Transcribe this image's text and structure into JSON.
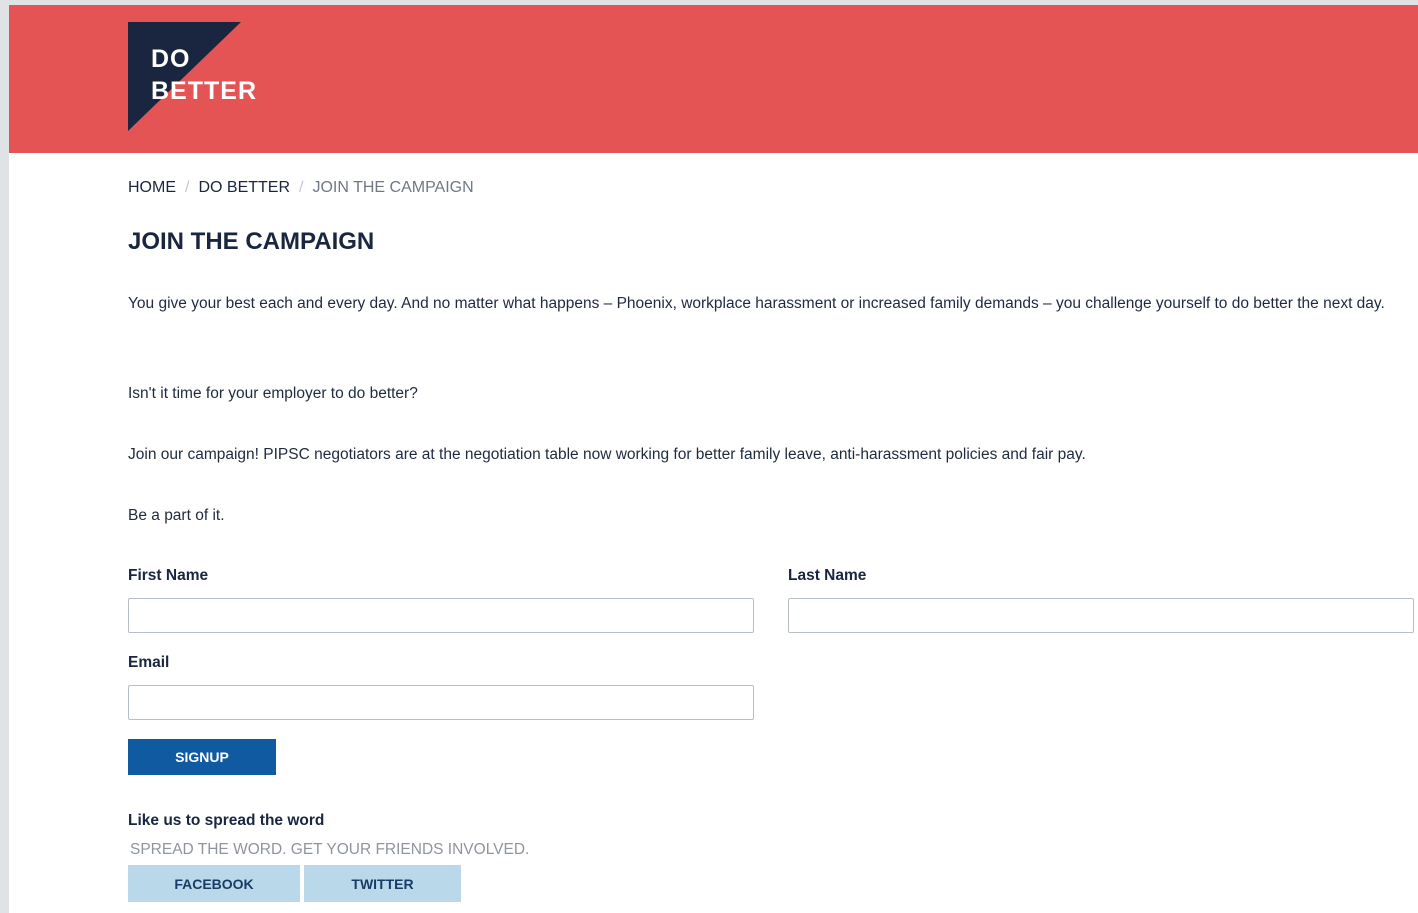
{
  "header": {
    "logo_line1": "DO",
    "logo_line2": "BETTER",
    "background_color": "#e45454",
    "logo_triangle_color": "#1a2640"
  },
  "breadcrumb": {
    "items": [
      "HOME",
      "DO BETTER",
      "JOIN THE CAMPAIGN"
    ],
    "separator": "/"
  },
  "page_title": "JOIN THE CAMPAIGN",
  "paragraphs": [
    "You give your best each and every day. And no matter what happens – Phoenix, workplace harassment or increased family demands – you challenge yourself to do better the next day.",
    "Isn't it time for your employer to do better?",
    "Join our campaign! PIPSC negotiators are at the negotiation table now working for better family leave, anti-harassment policies and fair pay.",
    "Be a part of it."
  ],
  "form": {
    "first_name_label": "First Name",
    "first_name_value": "",
    "last_name_label": "Last Name",
    "last_name_value": "",
    "email_label": "Email",
    "email_value": "",
    "signup_label": "SIGNUP",
    "signup_color": "#0f5aa0"
  },
  "share": {
    "heading": "Like us to spread the word",
    "subheading": "SPREAD THE WORD. GET YOUR FRIENDS INVOLVED.",
    "facebook_label": "FACEBOOK",
    "twitter_label": "TWITTER",
    "button_color": "#b9d9ea"
  }
}
